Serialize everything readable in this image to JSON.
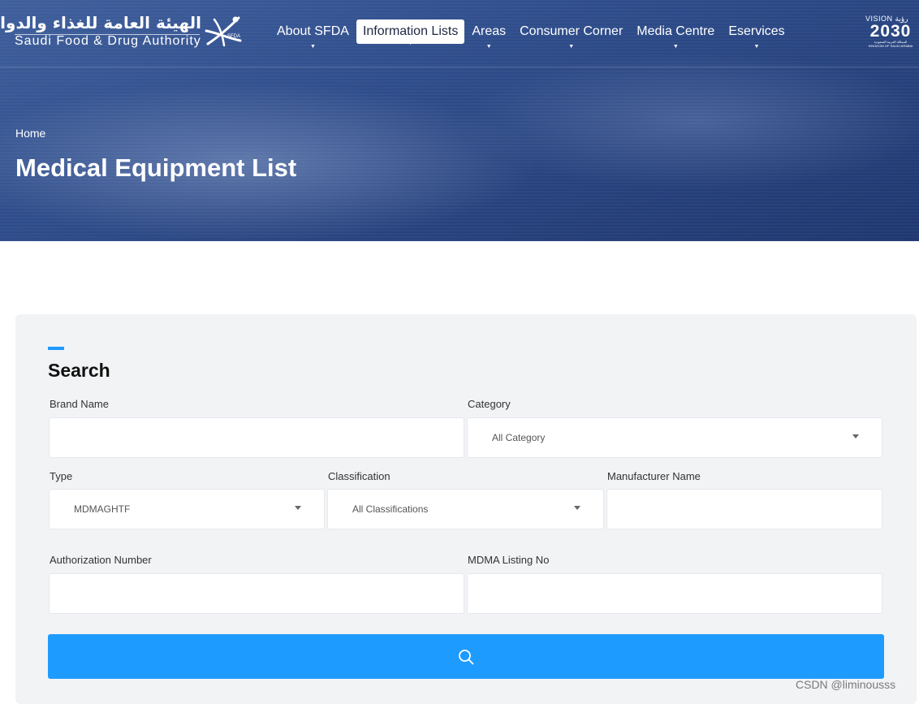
{
  "header": {
    "logo_ar": "الهيئة العامة للغذاء والدواء",
    "logo_en": "Saudi Food & Drug Authority",
    "logo_mark_text": "SFDA",
    "nav": [
      {
        "label": "About SFDA",
        "active": false
      },
      {
        "label": "Information Lists",
        "active": true
      },
      {
        "label": "Areas",
        "active": false
      },
      {
        "label": "Consumer Corner",
        "active": false
      },
      {
        "label": "Media Centre",
        "active": false
      },
      {
        "label": "Eservices",
        "active": false
      }
    ],
    "vision": {
      "top": "VISION رؤية",
      "number": "2030",
      "sub_ar": "المملكة العربية السعودية",
      "sub_en": "KINGDOM OF SAUDI ARABIA"
    }
  },
  "hero": {
    "breadcrumb": "Home",
    "title": "Medical Equipment List"
  },
  "search": {
    "heading": "Search",
    "brand_name": {
      "label": "Brand Name",
      "value": ""
    },
    "category": {
      "label": "Category",
      "value": "All Category"
    },
    "type": {
      "label": "Type",
      "value": "MDMAGHTF"
    },
    "classification": {
      "label": "Classification",
      "value": "All Classifications"
    },
    "manufacturer": {
      "label": "Manufacturer Name",
      "value": ""
    },
    "authorization": {
      "label": "Authorization Number",
      "value": ""
    },
    "mdma_listing": {
      "label": "MDMA Listing No",
      "value": ""
    },
    "button_icon": "search-icon"
  },
  "watermark": "CSDN @liminousss",
  "colors": {
    "accent": "#1e9bff",
    "hero_blue": "#2e4c8a",
    "panel_bg": "#f2f3f5"
  }
}
